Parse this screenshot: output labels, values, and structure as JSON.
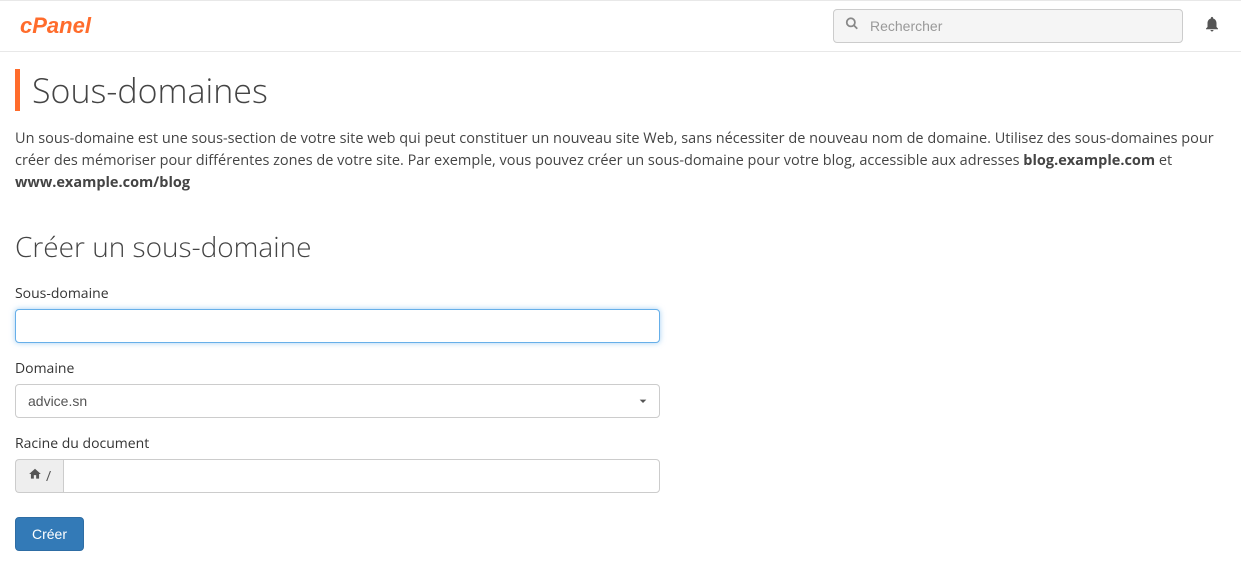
{
  "header": {
    "search_placeholder": "Rechercher"
  },
  "page": {
    "title": "Sous-domaines",
    "description_prefix": "Un sous-domaine est une sous-section de votre site web qui peut constituer un nouveau site Web, sans nécessiter de nouveau nom de domaine. Utilisez des sous-domaines pour créer des mémoriser pour différentes zones de votre site. Par exemple, vous pouvez créer un sous-domaine pour votre blog, accessible aux adresses ",
    "example1": "blog.example.com",
    "description_middle": " et ",
    "example2": "www.example.com/blog"
  },
  "form": {
    "section_title": "Créer un sous-domaine",
    "subdomain_label": "Sous-domaine",
    "subdomain_value": "",
    "domain_label": "Domaine",
    "domain_selected": "advice.sn",
    "docroot_label": "Racine du document",
    "docroot_prefix": "/",
    "docroot_value": "",
    "submit_label": "Créer"
  }
}
